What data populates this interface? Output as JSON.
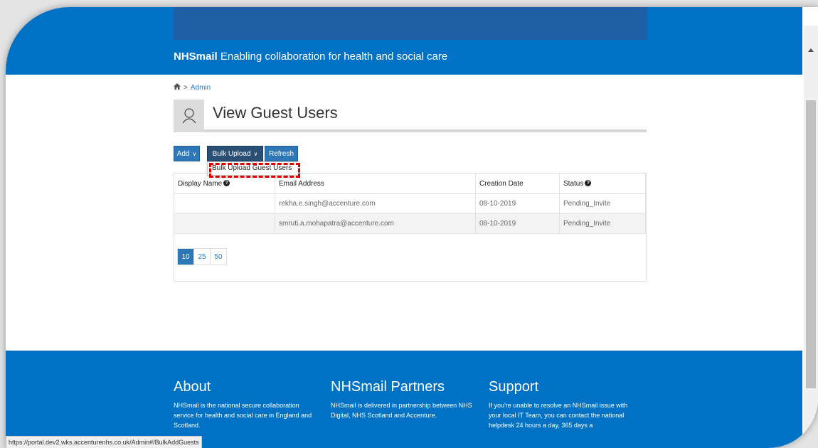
{
  "header": {
    "brand_bold": "NHSmail",
    "brand_text": " Enabling collaboration for health and social care"
  },
  "breadcrumb": {
    "home_icon": "home-icon",
    "separator": ">",
    "current": "Admin"
  },
  "page": {
    "title": "View Guest Users",
    "title_icon": "user-icon"
  },
  "toolbar": {
    "add_label": "Add",
    "bulk_label": "Bulk Upload",
    "refresh_label": "Refresh",
    "caret": "∨",
    "dropdown_item": "Bulk Upload Guest Users"
  },
  "table": {
    "columns": [
      "Display Name",
      "Email Address",
      "Creation Date",
      "Status"
    ],
    "help_icon": "?",
    "rows": [
      {
        "display_name": "",
        "email": "rekha.e.singh@accenture.com",
        "date": "08-10-2019",
        "status": "Pending_Invite"
      },
      {
        "display_name": "",
        "email": "smruti.a.mohapatra@accenture.com",
        "date": "08-10-2019",
        "status": "Pending_Invite"
      }
    ]
  },
  "pagination": {
    "sizes": [
      "10",
      "25",
      "50"
    ],
    "active": "10"
  },
  "footer": {
    "about_title": "About",
    "about_text": "NHSmail is the national secure collaboration service for health and social care in England and Scotland.",
    "partners_title": "NHSmail Partners",
    "partners_text": "NHSmail is delivered in partnership between NHS Digital, NHS Scotland and Accenture.",
    "support_title": "Support",
    "support_text": "If you're unable to resolve an NHSmail issue with your local IT Team, you can contact the national helpdesk 24 hours a day, 365 days a"
  },
  "statusbar": {
    "url": "https://portal.dev2.wks.accenturenhs.co.uk/Admin#/BulkAddGuests"
  },
  "colors": {
    "brand_blue": "#0072c6",
    "button_blue": "#2e77b7",
    "highlight_red": "#e00000"
  }
}
